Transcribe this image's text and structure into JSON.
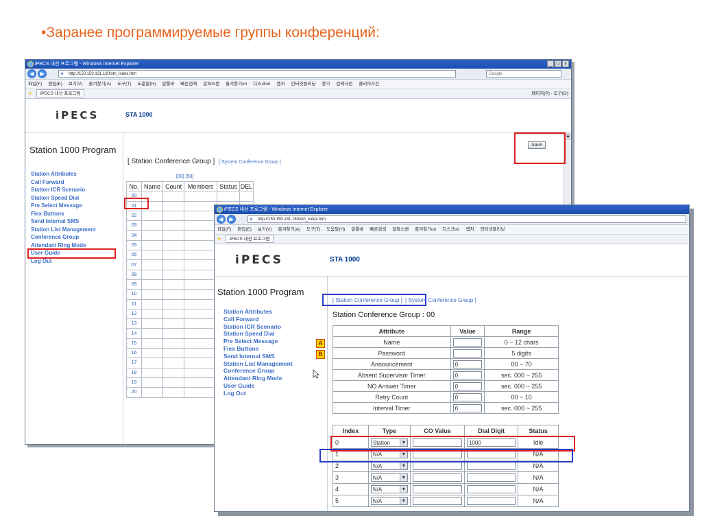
{
  "slide": {
    "bullet": "•",
    "title": "Заранее программируемые группы конференций:"
  },
  "back": {
    "window_title": "iPECS 내선 프로그램 - Windows Internet Explorer",
    "url": "http://150.150.131.180/stn_index.htm",
    "search": "Google",
    "menu": [
      "파일(F)",
      "편집(E)",
      "보기(V)",
      "즐겨찾기(A)",
      "도구(T)",
      "도움말(H)",
      "알툴바",
      "빠른검색",
      "알파스캔",
      "즐겨찾기on",
      "디스크on",
      "캡처",
      "인터넷클리닝",
      "찾기",
      "검색사전",
      "클리어사진"
    ],
    "tab": "iPECS 내선 프로그램",
    "tools": "페이지(P) · 도구(O)",
    "logo": "iPECS",
    "model": "STA 1000",
    "sidebar_title": "Station 1000 Program",
    "nav": [
      "Station Attributes",
      "Call Forward",
      "Station ICR Scenario",
      "Station Speed Dial",
      "Pre Select Message",
      "Flex Buttons",
      "Send Internal SMS",
      "Station List Management",
      "Conference Group",
      "Attendant Ring Mode",
      "User Guide",
      "Log Out"
    ],
    "heading": "[ Station Conference Group ]",
    "heading_link": "[ System Conference Group ]",
    "save": "Save",
    "pager": "[00] [50]",
    "columns": [
      "No.",
      "Name",
      "Count",
      "Members",
      "Status",
      "DEL"
    ],
    "rows": [
      "00",
      "01",
      "02",
      "03",
      "04",
      "05",
      "06",
      "07",
      "08",
      "09",
      "10",
      "11",
      "12",
      "13",
      "14",
      "15",
      "16",
      "17",
      "18",
      "19",
      "20"
    ]
  },
  "front": {
    "window_title": "iPECS 내선 프로그램 - Windows Internet Explorer",
    "url": "http://150.150.131.180/stn_index.htm",
    "menu": [
      "파일(F)",
      "편집(E)",
      "보기(V)",
      "즐겨찾기(A)",
      "도구(T)",
      "도움말(H)",
      "알툴바",
      "빠른검색",
      "알파스캔",
      "즐겨찾기on",
      "디스크on",
      "캡처",
      "인터넷클리닝"
    ],
    "tab": "iPECS 내선 프로그램",
    "logo": "iPECS",
    "model": "STA 1000",
    "sidebar_title": "Station 1000 Program",
    "nav": [
      "Station Attributes",
      "Call Forward",
      "Station ICR Scenario",
      "Station Speed Dial",
      "Pre Select Message",
      "Flex Buttons",
      "Send Internal SMS",
      "Station List Management",
      "Conference Group",
      "Attendant Ring Mode",
      "User Guide",
      "Log Out"
    ],
    "link_station": "[ Station Conference Group ]",
    "link_system": "[ System Conference Group ]",
    "group_title": "Station Conference Group : 00",
    "attr_headers": [
      "Attribute",
      "Value",
      "Range"
    ],
    "attributes": [
      {
        "name": "Name",
        "value": "",
        "range": "0 ~ 12 chars"
      },
      {
        "name": "Password",
        "value": "",
        "range": "5 digits"
      },
      {
        "name": "Announcement",
        "value": "0",
        "range": "00 ~ 70"
      },
      {
        "name": "Absent Supervisor Timer",
        "value": "0",
        "range": "sec. 000 ~ 255"
      },
      {
        "name": "NO Answer Timer",
        "value": "0",
        "range": "sec. 000 ~ 255"
      },
      {
        "name": "Retry Count",
        "value": "0",
        "range": "00 ~ 10"
      },
      {
        "name": "Interval Timer",
        "value": "0",
        "range": "sec. 000 ~ 255"
      }
    ],
    "badges": [
      "A",
      "B"
    ],
    "idx_headers": [
      "Index",
      "Type",
      "CO Value",
      "Dial Digit",
      "Status"
    ],
    "members": [
      {
        "index": "0",
        "type": "Station",
        "co": "",
        "dial": "1000",
        "status": "Idle"
      },
      {
        "index": "1",
        "type": "N/A",
        "co": "",
        "dial": "",
        "status": "N/A"
      },
      {
        "index": "2",
        "type": "N/A",
        "co": "",
        "dial": "",
        "status": "N/A"
      },
      {
        "index": "3",
        "type": "N/A",
        "co": "",
        "dial": "",
        "status": "N/A"
      },
      {
        "index": "4",
        "type": "N/A",
        "co": "",
        "dial": "",
        "status": "N/A"
      },
      {
        "index": "5",
        "type": "N/A",
        "co": "",
        "dial": "",
        "status": "N/A"
      }
    ]
  }
}
